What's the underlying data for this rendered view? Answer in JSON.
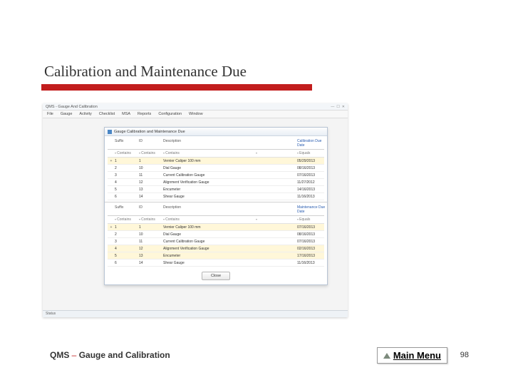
{
  "slide": {
    "title": "Calibration and Maintenance Due",
    "footer_prefix": "QMS",
    "footer_dash": " – ",
    "footer_suffix": "Gauge and Calibration",
    "main_menu_label": "Main Menu",
    "page_number": "98"
  },
  "app": {
    "window_title": "QMS - Gauge And Calibration",
    "menubar": {
      "items": [
        "File",
        "Gauge",
        "Activity",
        "Checklist",
        "MSA",
        "Reports",
        "Configuration",
        "Window"
      ]
    },
    "status_text": "Status",
    "child_window_title": "Gauge Calibration and Maintenance Due",
    "close_button": "Close",
    "section1": {
      "headers": {
        "suffix": "Suffix",
        "id": "ID",
        "desc": "Description",
        "date": "Calibration Due Date"
      },
      "filters": {
        "contains": "Contains",
        "equals": "Equals"
      },
      "rows": [
        {
          "marker": "+",
          "suffix": "1",
          "id": "1",
          "desc": "Vernier Caliper 100 mm",
          "date": "05/29/2013",
          "hl": true
        },
        {
          "marker": "",
          "suffix": "2",
          "id": "10",
          "desc": "Dial Gauge",
          "date": "08/16/2013",
          "hl": false
        },
        {
          "marker": "",
          "suffix": "3",
          "id": "11",
          "desc": "Current Calibration Gauge",
          "date": "07/16/2013",
          "hl": false
        },
        {
          "marker": "",
          "suffix": "4",
          "id": "12",
          "desc": "Alignment Verification Gauge",
          "date": "11/27/2012",
          "hl": false
        },
        {
          "marker": "",
          "suffix": "5",
          "id": "13",
          "desc": "Encumeter",
          "date": "14/16/2013",
          "hl": false
        },
        {
          "marker": "",
          "suffix": "6",
          "id": "14",
          "desc": "Shear Gauge",
          "date": "11/16/2013",
          "hl": false
        }
      ]
    },
    "section2": {
      "headers": {
        "suffix": "Suffix",
        "id": "ID",
        "desc": "Description",
        "date": "Maintenance Due Date"
      },
      "filters": {
        "contains": "Contains",
        "equals": "Equals"
      },
      "rows": [
        {
          "marker": "+",
          "suffix": "1",
          "id": "1",
          "desc": "Vernier Caliper 100 mm",
          "date": "07/16/2013",
          "hl": true
        },
        {
          "marker": "",
          "suffix": "2",
          "id": "10",
          "desc": "Dial Gauge",
          "date": "08/16/2013",
          "hl": false
        },
        {
          "marker": "",
          "suffix": "3",
          "id": "11",
          "desc": "Current Calibration Gauge",
          "date": "07/16/2013",
          "hl": false
        },
        {
          "marker": "",
          "suffix": "4",
          "id": "12",
          "desc": "Alignment Verification Gauge",
          "date": "02/16/2013",
          "hl": true
        },
        {
          "marker": "",
          "suffix": "5",
          "id": "13",
          "desc": "Encumeter",
          "date": "17/16/2013",
          "hl": true
        },
        {
          "marker": "",
          "suffix": "6",
          "id": "14",
          "desc": "Shear Gauge",
          "date": "11/16/2013",
          "hl": false
        }
      ]
    }
  }
}
